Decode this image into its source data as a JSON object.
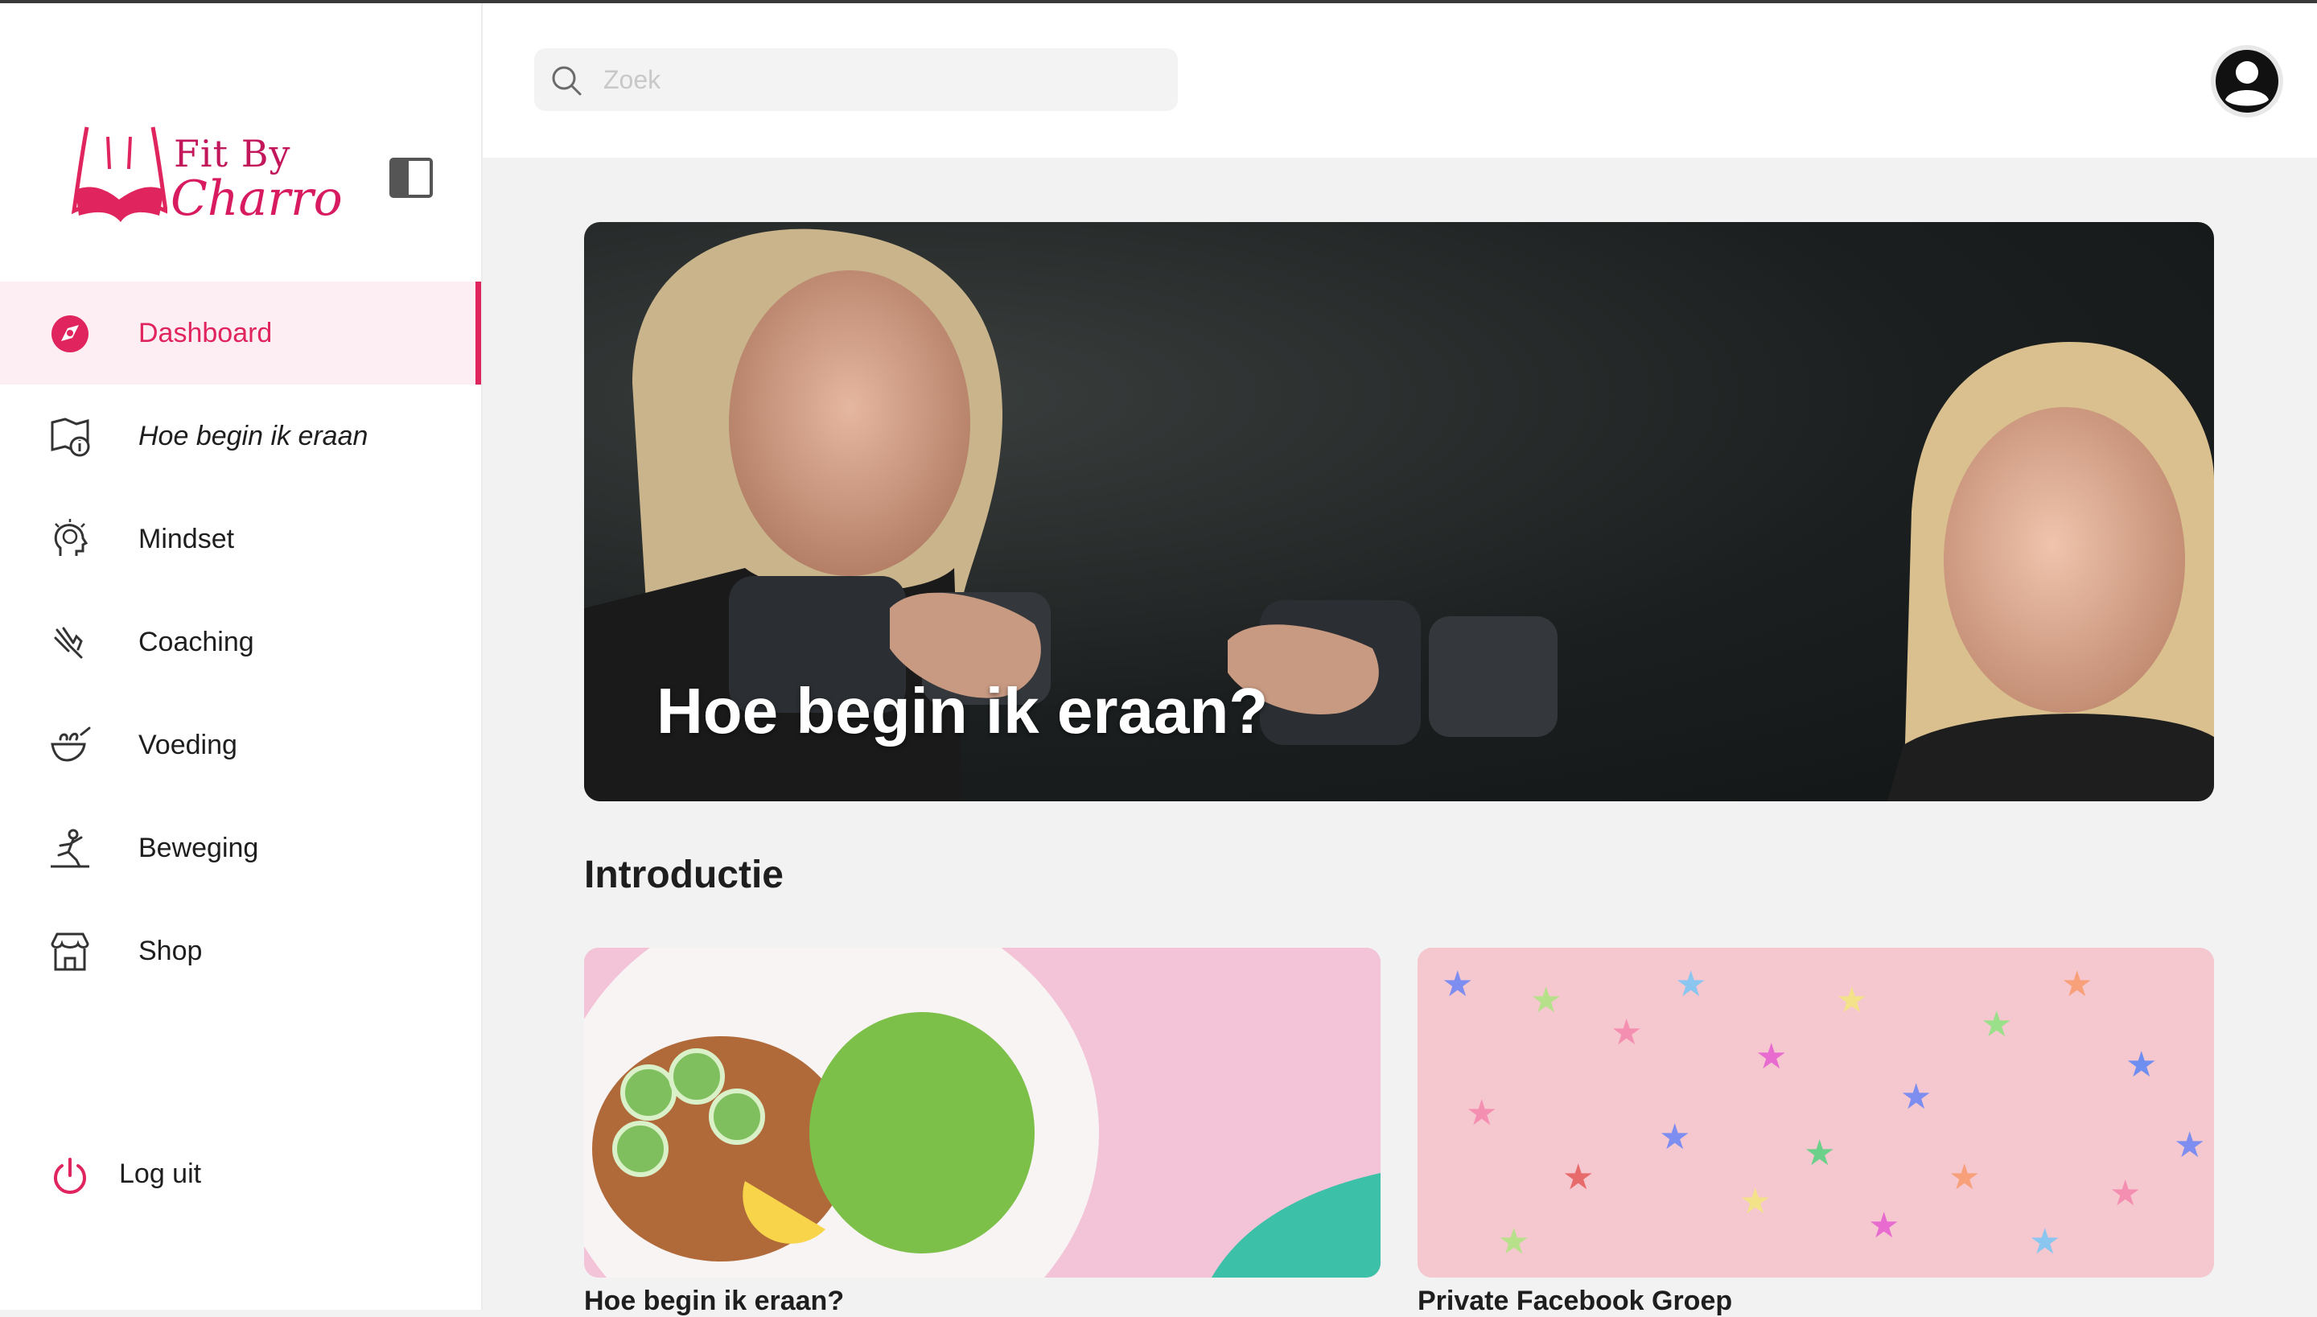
{
  "brand": {
    "line1": "Fit By",
    "line2": "Charro"
  },
  "search": {
    "placeholder": "Zoek"
  },
  "nav": [
    {
      "label": "Dashboard",
      "icon": "dashboard-icon",
      "active": true
    },
    {
      "label": "Hoe begin ik eraan",
      "icon": "info-book-icon"
    },
    {
      "label": "Mindset",
      "icon": "brain-head-icon"
    },
    {
      "label": "Coaching",
      "icon": "coaching-hand-icon"
    },
    {
      "label": "Voeding",
      "icon": "food-bowl-icon"
    },
    {
      "label": "Beweging",
      "icon": "exercise-person-icon"
    },
    {
      "label": "Shop",
      "icon": "shop-store-icon"
    }
  ],
  "logout": {
    "label": "Log uit",
    "icon": "power-icon"
  },
  "hero": {
    "title": "Hoe begin ik eraan?"
  },
  "section": {
    "title": "Introductie"
  },
  "cards": [
    {
      "title": "Hoe begin ik eraan?"
    },
    {
      "title": "Private Facebook Groep"
    }
  ],
  "colors": {
    "accent": "#e0245e",
    "active_bg": "#fdeef3",
    "page_bg": "#f2f2f2"
  }
}
